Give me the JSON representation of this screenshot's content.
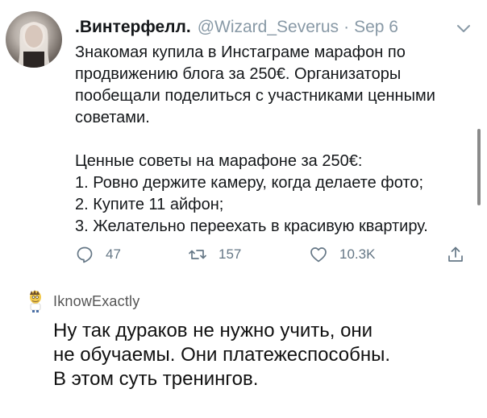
{
  "tweet": {
    "display_name": ".Винтерфелл.",
    "handle": "@Wizard_Severus",
    "separator": "·",
    "date": "Sep 6",
    "body_lines": [
      "Знакомая купила в Инстаграме марафон по",
      "продвижению блога за 250€. Организаторы",
      "пообещали поделиться с участниками ценными",
      "советами."
    ],
    "list_title": "Ценные советы на марафоне за 250€:",
    "list_items": [
      "1. Ровно держите камеру, когда делаете фото;",
      "2. Купите 11 айфон;",
      "3. Желательно переехать в красивую квартиру."
    ],
    "actions": {
      "replies": "47",
      "retweets": "157",
      "likes": "10.3K"
    }
  },
  "comment": {
    "username": "IknowExactly",
    "lines": [
      "Ну так дураков не нужно учить, они",
      "не обучаемы. Они платежеспособны.",
      "В этом суть тренингов."
    ]
  },
  "colors": {
    "text": "#14171a",
    "muted": "#8899a6",
    "icon": "#657786"
  },
  "icons": {
    "caret": "chevron-down-icon",
    "reply": "reply-icon",
    "retweet": "retweet-icon",
    "like": "heart-icon",
    "share": "share-icon"
  }
}
